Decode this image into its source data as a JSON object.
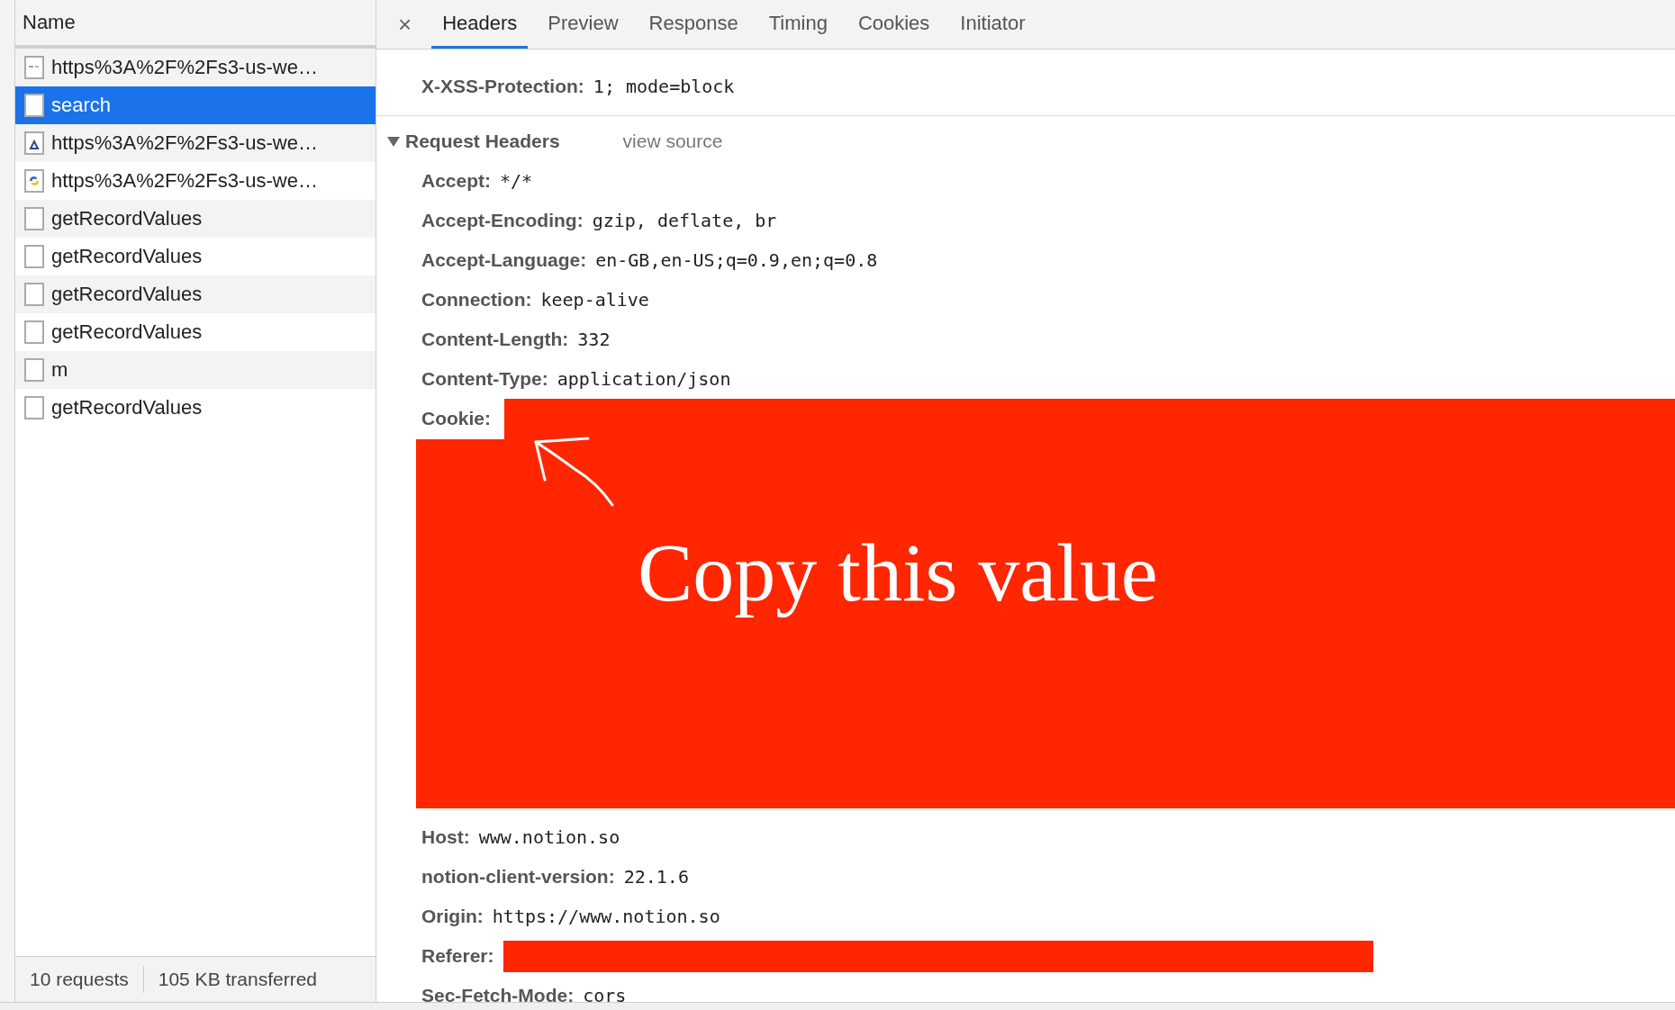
{
  "network_list": {
    "column_header": "Name",
    "requests": [
      {
        "name": "https%3A%2F%2Fs3-us-we…",
        "kind": "image",
        "selected": false
      },
      {
        "name": "search",
        "kind": "blank",
        "selected": true
      },
      {
        "name": "https%3A%2F%2Fs3-us-we…",
        "kind": "triangle",
        "selected": false
      },
      {
        "name": "https%3A%2F%2Fs3-us-we…",
        "kind": "snake",
        "selected": false
      },
      {
        "name": "getRecordValues",
        "kind": "blank",
        "selected": false
      },
      {
        "name": "getRecordValues",
        "kind": "blank",
        "selected": false
      },
      {
        "name": "getRecordValues",
        "kind": "blank",
        "selected": false
      },
      {
        "name": "getRecordValues",
        "kind": "blank",
        "selected": false
      },
      {
        "name": "m",
        "kind": "blank",
        "selected": false
      },
      {
        "name": "getRecordValues",
        "kind": "blank",
        "selected": false
      }
    ]
  },
  "status_bar": {
    "requests": "10 requests",
    "transferred": "105 KB transferred"
  },
  "detail_tabs": {
    "close": "×",
    "tabs": [
      {
        "label": "Headers",
        "selected": true
      },
      {
        "label": "Preview",
        "selected": false
      },
      {
        "label": "Response",
        "selected": false
      },
      {
        "label": "Timing",
        "selected": false
      },
      {
        "label": "Cookies",
        "selected": false
      },
      {
        "label": "Initiator",
        "selected": false
      }
    ]
  },
  "response_headers_tail": [
    {
      "name": "X-XSS-Protection:",
      "value": "1; mode=block"
    }
  ],
  "request_headers": {
    "title": "Request Headers",
    "expanded": true,
    "view_source": "view source",
    "headers": [
      {
        "name": "Accept:",
        "value": "*/*",
        "kind": "plain"
      },
      {
        "name": "Accept-Encoding:",
        "value": "gzip, deflate, br",
        "kind": "plain"
      },
      {
        "name": "Accept-Language:",
        "value": "en-GB,en-US;q=0.9,en;q=0.8",
        "kind": "plain"
      },
      {
        "name": "Connection:",
        "value": "keep-alive",
        "kind": "plain"
      },
      {
        "name": "Content-Length:",
        "value": "332",
        "kind": "plain"
      },
      {
        "name": "Content-Type:",
        "value": "application/json",
        "kind": "plain"
      },
      {
        "name": "Cookie:",
        "note": "Copy this value",
        "kind": "redacted_block"
      },
      {
        "name": "Host:",
        "value": "www.notion.so",
        "kind": "plain"
      },
      {
        "name": "notion-client-version:",
        "value": "22.1.6",
        "kind": "plain"
      },
      {
        "name": "Origin:",
        "value": "https://www.notion.so",
        "kind": "plain"
      },
      {
        "name": "Referer:",
        "kind": "redacted_bar"
      },
      {
        "name": "Sec-Fetch-Mode:",
        "value": "cors",
        "kind": "plain"
      }
    ]
  }
}
